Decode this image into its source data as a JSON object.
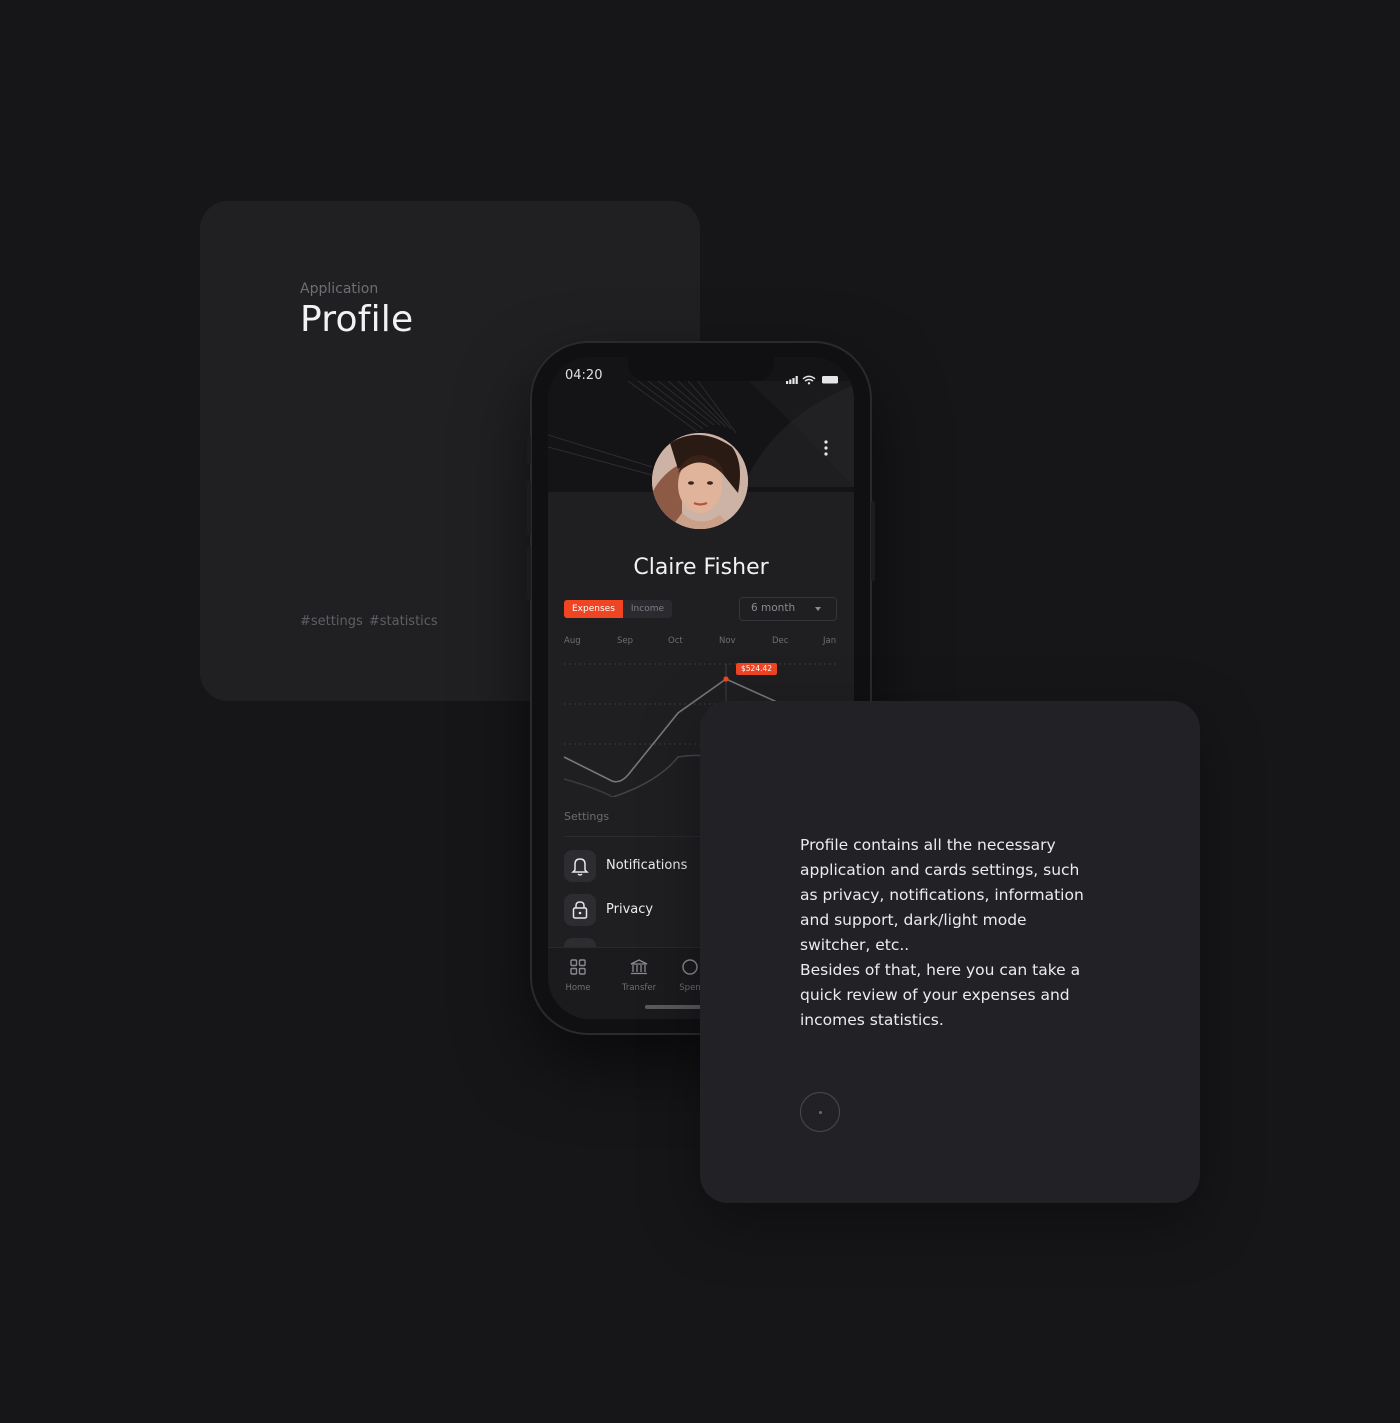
{
  "intro_card": {
    "eyebrow": "Application",
    "title": "Profile",
    "tags": "#settings  #statistics"
  },
  "phone": {
    "status_time": "04:20",
    "user_name": "Claire Fisher",
    "segment": {
      "active": "Expenses",
      "inactive": "Income"
    },
    "period_select": "6 month",
    "months": [
      "Aug",
      "Sep",
      "Oct",
      "Nov",
      "Dec",
      "Jan"
    ],
    "tooltip_value": "$524.42",
    "settings_title": "Settings",
    "settings": [
      {
        "label": "Notifications",
        "icon": "bell-icon"
      },
      {
        "label": "Privacy",
        "icon": "lock-icon"
      }
    ],
    "tabs": [
      {
        "label": "Home",
        "icon": "grid-icon"
      },
      {
        "label": "Transfer",
        "icon": "bank-icon"
      },
      {
        "label": "Spen",
        "icon": "spending-icon"
      }
    ]
  },
  "info_card": {
    "paragraph1": "Profile contains all the necessary application and cards settings, such as privacy, notifications, information and support, dark/light mode switcher, etc..",
    "paragraph2": "Besides of that, here you can take a quick review of your expenses and incomes statistics."
  },
  "colors": {
    "accent": "#ef4523",
    "background": "#161619",
    "card": "#222226"
  },
  "chart_data": {
    "type": "line",
    "categories": [
      "Aug",
      "Sep",
      "Oct",
      "Nov",
      "Dec",
      "Jan"
    ],
    "highlight": {
      "category": "Nov",
      "label": "$524.42"
    }
  }
}
